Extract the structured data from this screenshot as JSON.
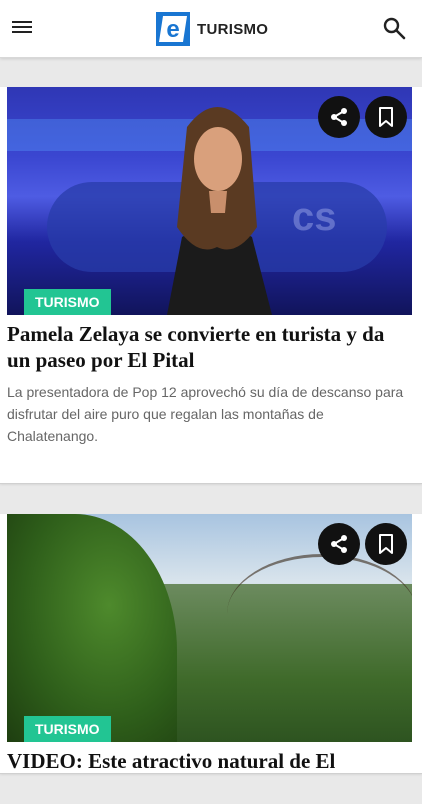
{
  "header": {
    "logo_letter": "e",
    "logo_text": "TURISMO",
    "menu_icon": "hamburger-menu-icon",
    "search_icon": "search-icon",
    "brand_color": "#1976d2"
  },
  "articles": [
    {
      "tag": "TURISMO",
      "title": "Pamela Zelaya se convierte en turista y da un paseo por El Pital",
      "summary": "La presentadora de Pop 12 aprovechó su día de descanso para disfrutar del aire puro que regalan las montañas de Chalatenango.",
      "image_logo_text": "cs",
      "share_icon": "share-icon",
      "bookmark_icon": "bookmark-icon"
    },
    {
      "tag": "TURISMO",
      "title": "VIDEO: Este atractivo natural de El",
      "share_icon": "share-icon",
      "bookmark_icon": "bookmark-icon"
    }
  ],
  "colors": {
    "tag_bg": "#22c593",
    "fab_bg": "#111111"
  }
}
